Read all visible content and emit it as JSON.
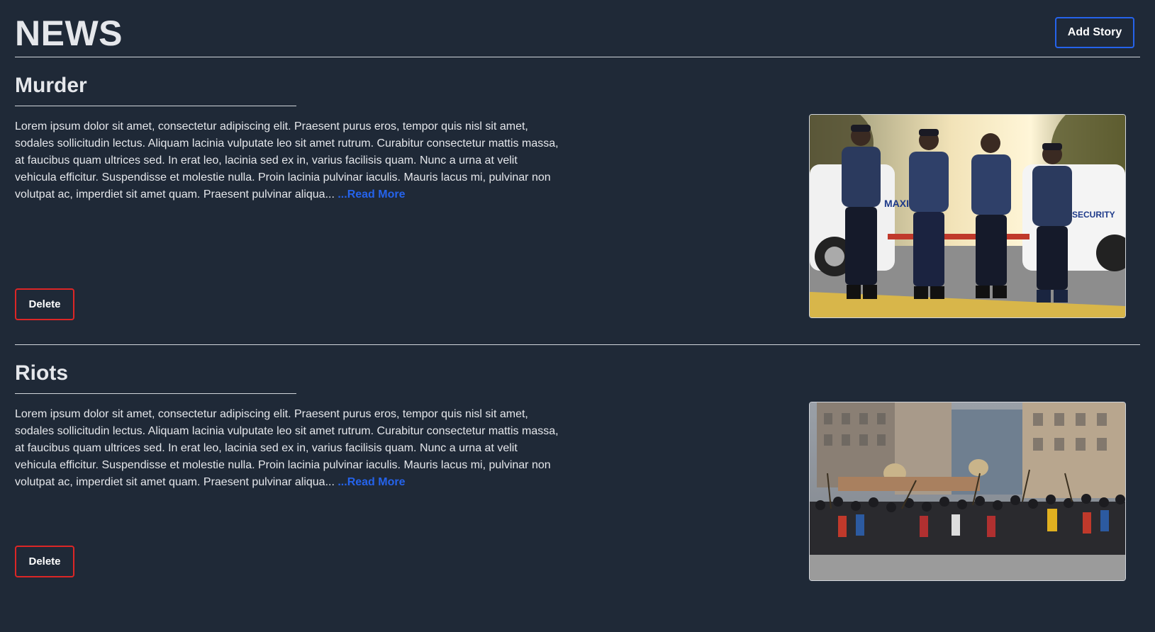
{
  "header": {
    "title": "NEWS",
    "add_story_label": "Add Story"
  },
  "stories": [
    {
      "title": "Murder",
      "excerpt": "Lorem ipsum dolor sit amet, consectetur adipiscing elit. Praesent purus eros, tempor quis nisl sit amet, sodales sollicitudin lectus. Aliquam lacinia vulputate leo sit amet rutrum. Curabitur consectetur mattis massa, at faucibus quam ultrices sed. In erat leo, lacinia sed ex in, varius facilisis quam. Nunc a urna at velit vehicula efficitur. Suspendisse et molestie nulla. Proin lacinia pulvinar iaculis. Mauris lacus mi, pulvinar non volutpat ac, imperdiet sit amet quam. Praesent pulvinar aliqua...",
      "read_more_label": "...Read More",
      "delete_label": "Delete",
      "image": "security-guards-photo",
      "image_vehicle_text": [
        "MAXI",
        "SECURITY"
      ]
    },
    {
      "title": "Riots",
      "excerpt": "Lorem ipsum dolor sit amet, consectetur adipiscing elit. Praesent purus eros, tempor quis nisl sit amet, sodales sollicitudin lectus. Aliquam lacinia vulputate leo sit amet rutrum. Curabitur consectetur mattis massa, at faucibus quam ultrices sed. In erat leo, lacinia sed ex in, varius facilisis quam. Nunc a urna at velit vehicula efficitur. Suspendisse et molestie nulla. Proin lacinia pulvinar iaculis. Mauris lacus mi, pulvinar non volutpat ac, imperdiet sit amet quam. Praesent pulvinar aliqua...",
      "read_more_label": "...Read More",
      "delete_label": "Delete",
      "image": "crowd-riot-photo"
    }
  ],
  "colors": {
    "background": "#1f2937",
    "accent": "#2563eb",
    "danger": "#dc2626",
    "text": "#e5e7eb"
  }
}
